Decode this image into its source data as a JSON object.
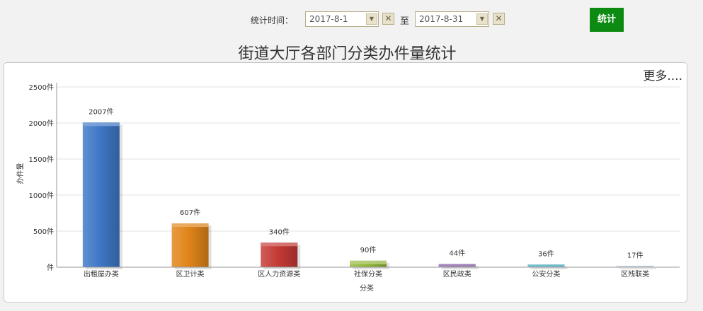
{
  "filter": {
    "label": "统计时间：",
    "start_date": "2017-8-1",
    "to_label": "至",
    "end_date": "2017-8-31",
    "submit_label": "统计",
    "clear_glyph": "✕",
    "dropdown_glyph": "▼"
  },
  "more_link": "更多....",
  "chart_data": {
    "type": "bar",
    "title": "街道大厅各部门分类办件量统计",
    "xlabel": "分类",
    "ylabel": "办件量",
    "ylim": [
      0,
      2500
    ],
    "yticks": [
      0,
      500,
      1000,
      1500,
      2000,
      2500
    ],
    "ytick_labels": [
      "件",
      "500件",
      "1000件",
      "1500件",
      "2000件",
      "2500件"
    ],
    "categories": [
      "出租屋办类",
      "区卫计类",
      "区人力资源类",
      "社保分类",
      "区民政类",
      "公安分类",
      "区残联类"
    ],
    "values": [
      2007,
      607,
      340,
      90,
      44,
      36,
      17
    ],
    "value_labels": [
      "2007件",
      "607件",
      "340件",
      "90件",
      "44件",
      "36件",
      "17件"
    ],
    "colors": [
      "#3f78c8",
      "#e0851a",
      "#c53a36",
      "#93b83b",
      "#7a4f9c",
      "#36a2b7",
      "#9bbbd9"
    ],
    "grid": true
  },
  "colors": {
    "submit_button": "#0d8a12",
    "background": "#f1f2f1"
  }
}
